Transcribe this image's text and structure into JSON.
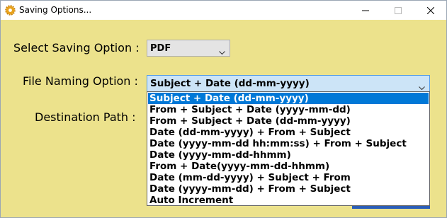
{
  "window": {
    "title": "Saving Options...",
    "icon": "gear-icon"
  },
  "form": {
    "saving_option_label": "Select Saving Option :",
    "saving_option_value": "PDF",
    "file_naming_label": "File Naming Option :",
    "file_naming_value": "Subject + Date (dd-mm-yyyy)",
    "destination_label": "Destination Path :"
  },
  "dropdown": {
    "options": [
      "Subject + Date (dd-mm-yyyy)",
      "From + Subject + Date (yyyy-mm-dd)",
      "From + Subject + Date (dd-mm-yyyy)",
      "Date (dd-mm-yyyy) + From + Subject",
      "Date (yyyy-mm-dd hh:mm:ss) + From + Subject",
      "Date (yyyy-mm-dd-hhmm)",
      "From + Date(yyyy-mm-dd-hhmm)",
      "Date (mm-dd-yyyy) + Subject + From",
      "Date (yyyy-mm-dd) + From + Subject",
      "Auto Increment"
    ],
    "selected": "Subject + Date (dd-mm-yyyy)"
  },
  "colors": {
    "dialog_bg": "#ece28c",
    "selection": "#0078d7",
    "combo_focus": "#cce4f7"
  }
}
